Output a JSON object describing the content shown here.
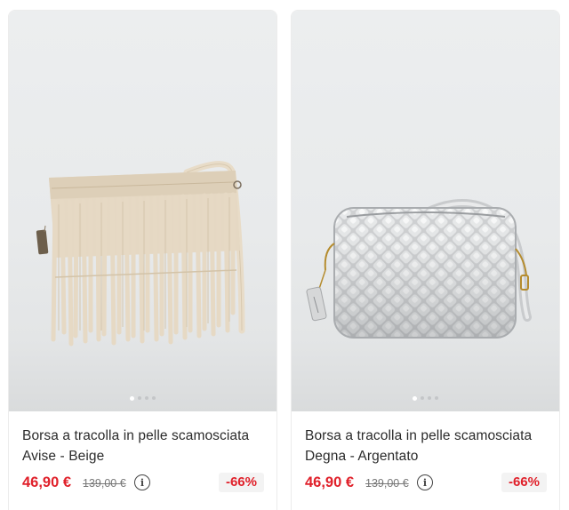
{
  "products": [
    {
      "title": "Borsa a tracolla in pelle scamosciata Avise - Beige",
      "price": "46,90 €",
      "old_price": "139,00 €",
      "discount": "-66%",
      "image": "beige-suede-fringe-crossbody-bag",
      "image_color": "#e2d5c0",
      "carousel": {
        "count": 4,
        "active": 1
      }
    },
    {
      "title": "Borsa a tracolla in pelle scamosciata Degna - Argentato",
      "price": "46,90 €",
      "old_price": "139,00 €",
      "discount": "-66%",
      "image": "silver-woven-leather-crossbody-bag",
      "image_color": "#c9cbcd",
      "carousel": {
        "count": 4,
        "active": 1
      }
    }
  ],
  "colors": {
    "price": "#e0202a",
    "discount_bg": "#f3f3f3",
    "card_border": "#ececec"
  },
  "icons": {
    "info": "info-icon"
  }
}
